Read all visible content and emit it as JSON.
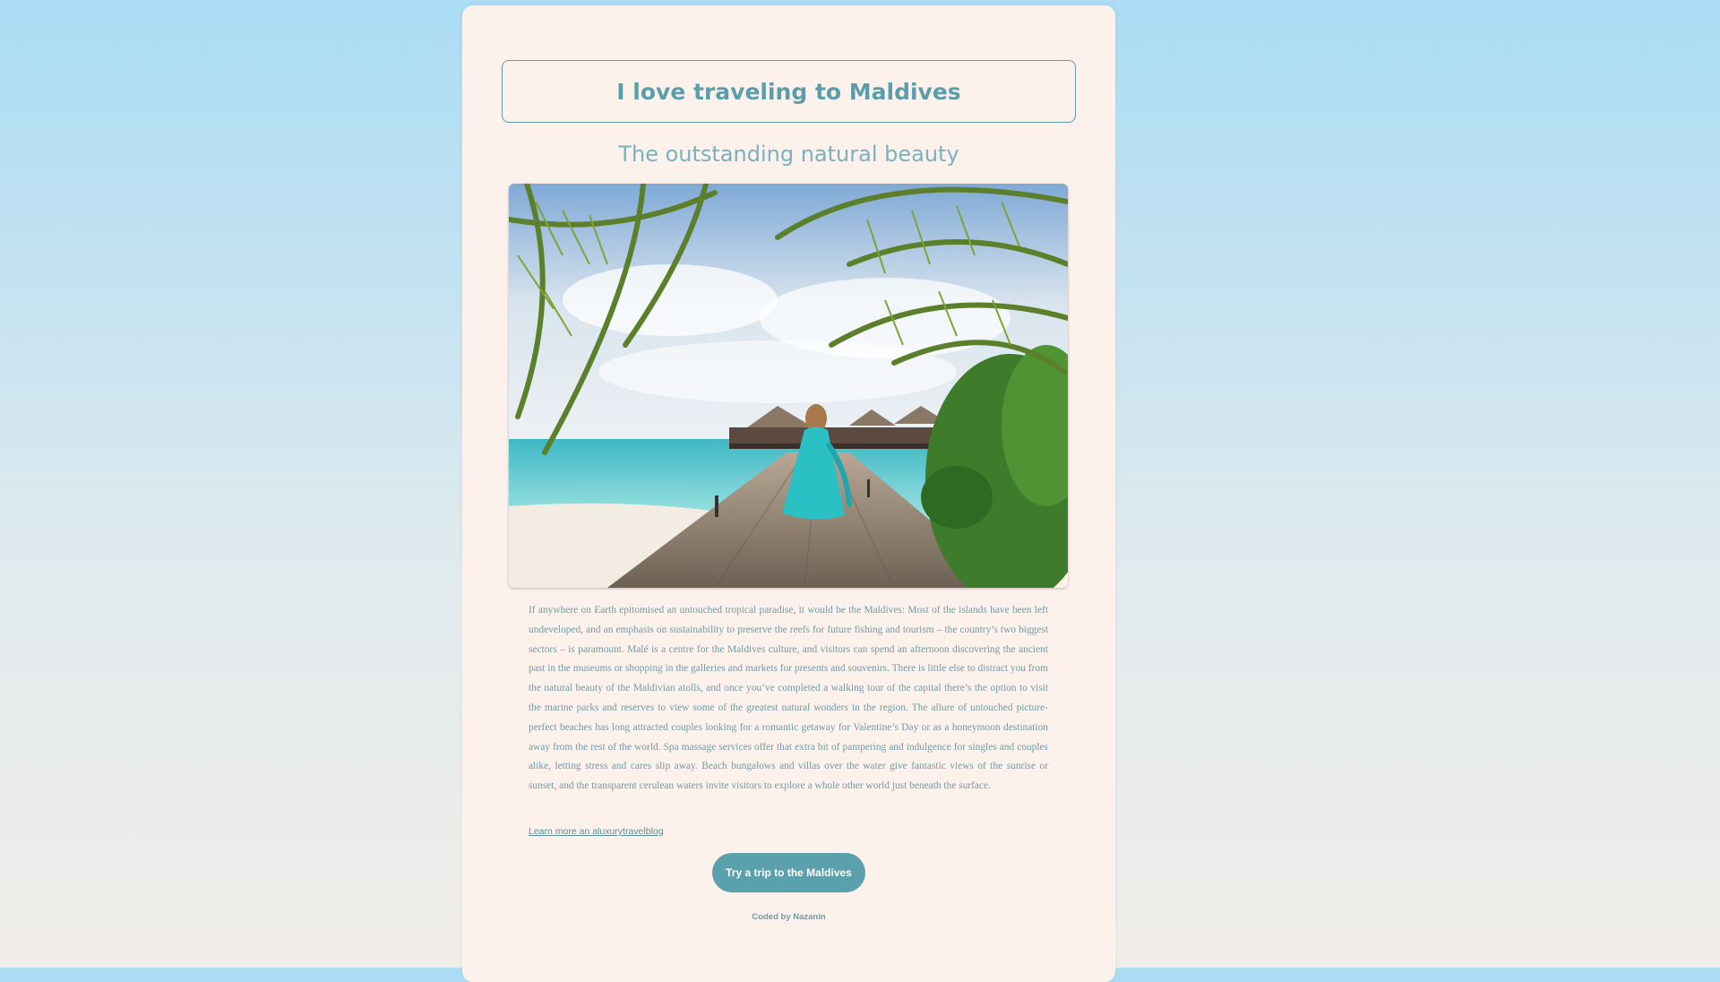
{
  "header": {
    "title": "I love traveling to Maldives",
    "subtitle": "The outstanding natural beauty"
  },
  "hero_image": {
    "description_icon": "maldives-boardwalk-photo"
  },
  "article": {
    "body": "If anywhere on Earth epitomised an untouched tropical paradise, it would be the Maldives: Most of the islands have been left undeveloped, and an emphasis on sustainability to preserve the reefs for future fishing and tourism – the country’s two biggest sectors – is paramount. Malé is a centre for the Maldives culture, and visitors can spend an afternoon discovering the ancient past in the museums or shopping in the galleries and markets for presents and souvenirs. There is little else to distract you from the natural beauty of the Maldivian atolls, and once you’ve completed a walking tour of the capital there’s the option to visit the marine parks and reserves to view some of the greatest natural wonders in the region. The allure of untouched picture-perfect beaches has long attracted couples looking for a romantic getaway for Valentine’s Day or as a honeymoon destination away from the rest of the world. Spa massage services offer that extra bit of pampering and indulgence for singles and couples alike, letting stress and cares slip away. Beach bungalows and villas over the water give fantastic views of the sunrise or sunset, and the transparent cerulean waters invite visitors to explore a whole other world just beneath the surface.",
    "link_label": "Learn more an aluxurytravelblog"
  },
  "cta": {
    "label": "Try a trip to the Maldives"
  },
  "footer": {
    "credit": "Coded by Nazanin"
  },
  "colors": {
    "accent": "#5aa1ad",
    "title": "#5b9ea9",
    "card_background": "#fdf1ec",
    "text": "#6f9ba5"
  }
}
